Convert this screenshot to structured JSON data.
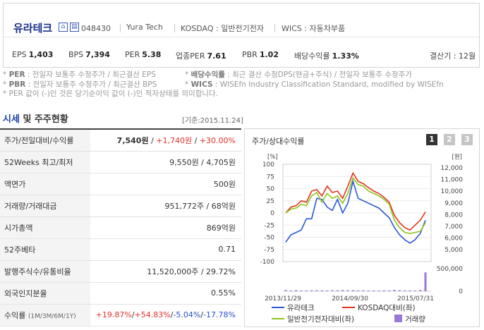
{
  "company": {
    "name": "유라테크",
    "code": "048430",
    "english_name": "Yura Tech",
    "market": "KOSDAQ : 일반전기전자",
    "wics": "WICS : 자동차부품"
  },
  "metrics": [
    {
      "label": "EPS",
      "value": "1,403"
    },
    {
      "label": "BPS",
      "value": "7,394"
    },
    {
      "label": "PER",
      "value": "5.38"
    },
    {
      "label": "업종PER",
      "value": "7.61"
    },
    {
      "label": "PBR",
      "value": "1.02"
    },
    {
      "label": "배당수익률",
      "value": "1.33%"
    }
  ],
  "fiscal": "결산기 : 12월",
  "notes": [
    {
      "key": "PER",
      "text": " : 전일자 보통주 수정주가 / 최근결산 EPS",
      "key2": "배당수익률",
      "text2": " : 최근 결산 수정DPS(현금+주식) / 전일자 보통주 수정주가"
    },
    {
      "key": "PBR",
      "text": " : 전일자 보통주 수정주가 / 최근결산 BPS",
      "key2": "WICS",
      "text2": " : WISEfn Industry Classification Standard, modified by WISEfn"
    },
    {
      "plain": "* PER 값이 (-)인 것은 당기순이익 값이 (-)인 적자상태를 의미합니다."
    }
  ],
  "section": {
    "title_a": "시세",
    "title_b": " 및 주주현황",
    "date": "[기준:2015.11.24]"
  },
  "table": {
    "rows": [
      {
        "label": "주가/전일대비/수익률",
        "v1": "7,540원",
        "v2": "+1,740원",
        "v3": "+30.00%"
      },
      {
        "label": "52Weeks 최고/최저",
        "value": "9,550원 / 4,705원"
      },
      {
        "label": "액면가",
        "value": "500원"
      },
      {
        "label": "거래량/거래대금",
        "value": "951,772주 / 68억원"
      },
      {
        "label": "시가총액",
        "value": "869억원"
      },
      {
        "label": "52주베타",
        "value": "0.71"
      },
      {
        "label": "발행주식수/유통비율",
        "value": "11,520,000주 / 29.72%"
      },
      {
        "label": "외국인지분율",
        "value": "0.55%"
      },
      {
        "label": "수익률",
        "sub": "(1M/3M/6M/1Y)",
        "r1": "+19.87%",
        "r2": "+54.83%",
        "r3": "-5.04%",
        "r4": "-17.78%"
      }
    ]
  },
  "chart_panel": {
    "title": "주가/상대수익률",
    "pages": [
      "1",
      "2",
      "3"
    ],
    "active_page": "1"
  },
  "colors": {
    "series1": "#2a56d8",
    "series2": "#e0341c",
    "series3": "#8ec31c",
    "volume": "#9a78d8",
    "accent": "#1a3fa8"
  },
  "chart_data": {
    "type": "line",
    "left_axis": {
      "unit": "[%]",
      "ticks": [
        100,
        75,
        50,
        25,
        0,
        -25,
        -50,
        -75,
        -100
      ],
      "range": [
        -100,
        100
      ]
    },
    "right_axis": {
      "unit": "[원]",
      "ticks": [
        "12,000",
        "11,000",
        "10,000",
        "9,000",
        "8,000",
        "7,000",
        "6,000",
        "5,000"
      ],
      "range": [
        4000,
        12000
      ]
    },
    "volume_axis": {
      "ticks": [
        "500,000",
        "0"
      ],
      "range": [
        0,
        1000000
      ]
    },
    "x_ticks": [
      "2013/11/29",
      "2014/09/30",
      "2015/07/31"
    ],
    "series": [
      {
        "name": "유라테크",
        "color": "#2a56d8",
        "values": [
          -60,
          -45,
          -40,
          -35,
          -12,
          -12,
          30,
          28,
          12,
          5,
          28,
          0,
          20,
          65,
          30,
          25,
          20,
          15,
          10,
          0,
          -10,
          -30,
          -45,
          -55,
          -62,
          -55,
          -42,
          -15
        ]
      },
      {
        "name": "KOSDAQ대비(좌)",
        "color": "#e0341c",
        "values": [
          0,
          12,
          15,
          25,
          22,
          45,
          48,
          35,
          55,
          42,
          45,
          30,
          55,
          82,
          65,
          60,
          52,
          45,
          40,
          32,
          22,
          -5,
          -20,
          -30,
          -35,
          -25,
          -15,
          2
        ]
      },
      {
        "name": "일반전기전자대비(좌)",
        "color": "#8ec31c",
        "values": [
          0,
          8,
          10,
          18,
          15,
          35,
          42,
          22,
          40,
          30,
          35,
          20,
          40,
          72,
          58,
          55,
          45,
          40,
          35,
          28,
          18,
          -15,
          -30,
          -40,
          -42,
          -40,
          -38,
          -20
        ]
      }
    ],
    "volume": {
      "name": "거래량",
      "color": "#9a78d8",
      "values": [
        60000,
        20000,
        55000,
        30000,
        40000,
        45000,
        50000,
        45000,
        35000,
        50000,
        45000,
        60000,
        50000,
        55000,
        40000,
        45000,
        35000,
        40000,
        30000,
        45000,
        40000,
        70000,
        50000,
        45000,
        40000,
        30000,
        60000,
        951772
      ]
    }
  }
}
